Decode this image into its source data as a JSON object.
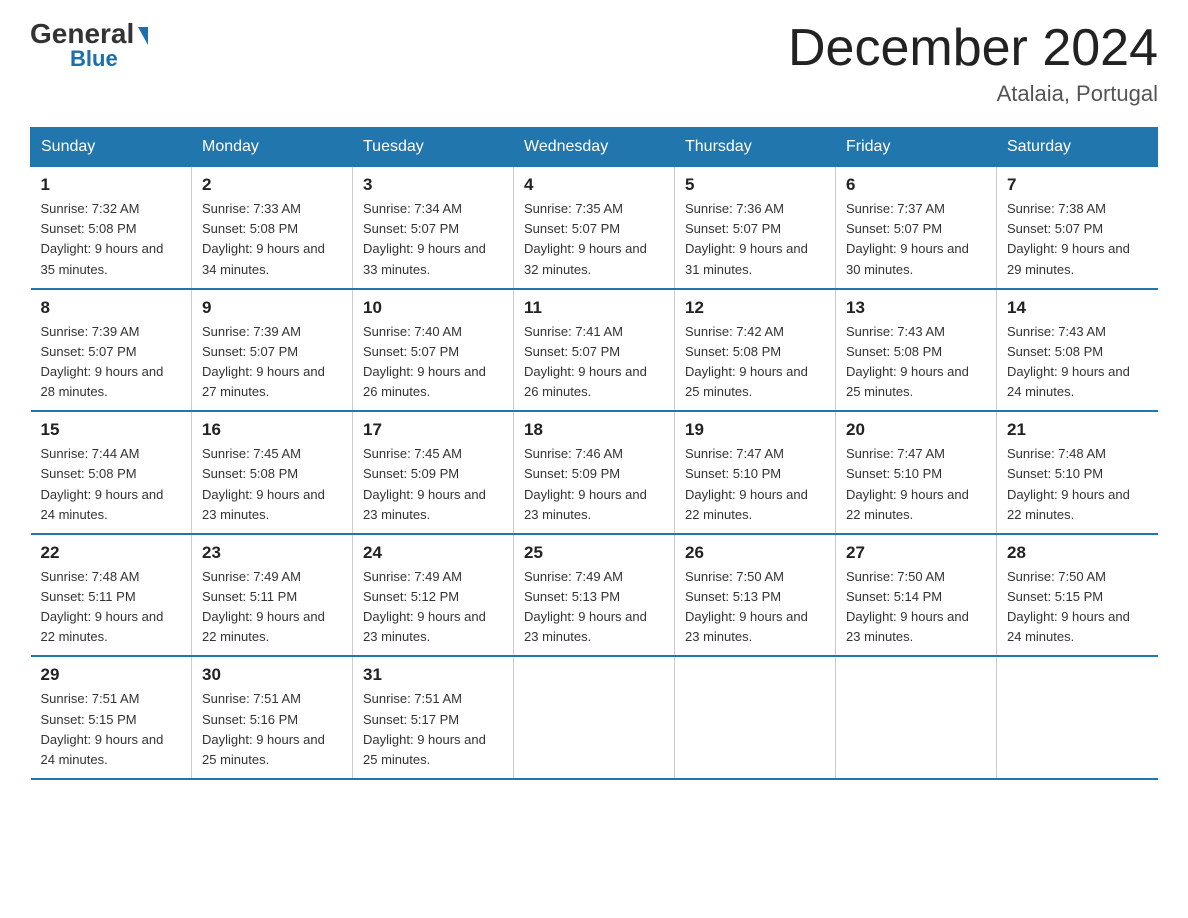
{
  "logo": {
    "text1": "General",
    "text2": "Blue"
  },
  "title": "December 2024",
  "location": "Atalaia, Portugal",
  "days_of_week": [
    "Sunday",
    "Monday",
    "Tuesday",
    "Wednesday",
    "Thursday",
    "Friday",
    "Saturday"
  ],
  "weeks": [
    [
      {
        "num": "1",
        "sunrise": "7:32 AM",
        "sunset": "5:08 PM",
        "daylight": "9 hours and 35 minutes."
      },
      {
        "num": "2",
        "sunrise": "7:33 AM",
        "sunset": "5:08 PM",
        "daylight": "9 hours and 34 minutes."
      },
      {
        "num": "3",
        "sunrise": "7:34 AM",
        "sunset": "5:07 PM",
        "daylight": "9 hours and 33 minutes."
      },
      {
        "num": "4",
        "sunrise": "7:35 AM",
        "sunset": "5:07 PM",
        "daylight": "9 hours and 32 minutes."
      },
      {
        "num": "5",
        "sunrise": "7:36 AM",
        "sunset": "5:07 PM",
        "daylight": "9 hours and 31 minutes."
      },
      {
        "num": "6",
        "sunrise": "7:37 AM",
        "sunset": "5:07 PM",
        "daylight": "9 hours and 30 minutes."
      },
      {
        "num": "7",
        "sunrise": "7:38 AM",
        "sunset": "5:07 PM",
        "daylight": "9 hours and 29 minutes."
      }
    ],
    [
      {
        "num": "8",
        "sunrise": "7:39 AM",
        "sunset": "5:07 PM",
        "daylight": "9 hours and 28 minutes."
      },
      {
        "num": "9",
        "sunrise": "7:39 AM",
        "sunset": "5:07 PM",
        "daylight": "9 hours and 27 minutes."
      },
      {
        "num": "10",
        "sunrise": "7:40 AM",
        "sunset": "5:07 PM",
        "daylight": "9 hours and 26 minutes."
      },
      {
        "num": "11",
        "sunrise": "7:41 AM",
        "sunset": "5:07 PM",
        "daylight": "9 hours and 26 minutes."
      },
      {
        "num": "12",
        "sunrise": "7:42 AM",
        "sunset": "5:08 PM",
        "daylight": "9 hours and 25 minutes."
      },
      {
        "num": "13",
        "sunrise": "7:43 AM",
        "sunset": "5:08 PM",
        "daylight": "9 hours and 25 minutes."
      },
      {
        "num": "14",
        "sunrise": "7:43 AM",
        "sunset": "5:08 PM",
        "daylight": "9 hours and 24 minutes."
      }
    ],
    [
      {
        "num": "15",
        "sunrise": "7:44 AM",
        "sunset": "5:08 PM",
        "daylight": "9 hours and 24 minutes."
      },
      {
        "num": "16",
        "sunrise": "7:45 AM",
        "sunset": "5:08 PM",
        "daylight": "9 hours and 23 minutes."
      },
      {
        "num": "17",
        "sunrise": "7:45 AM",
        "sunset": "5:09 PM",
        "daylight": "9 hours and 23 minutes."
      },
      {
        "num": "18",
        "sunrise": "7:46 AM",
        "sunset": "5:09 PM",
        "daylight": "9 hours and 23 minutes."
      },
      {
        "num": "19",
        "sunrise": "7:47 AM",
        "sunset": "5:10 PM",
        "daylight": "9 hours and 22 minutes."
      },
      {
        "num": "20",
        "sunrise": "7:47 AM",
        "sunset": "5:10 PM",
        "daylight": "9 hours and 22 minutes."
      },
      {
        "num": "21",
        "sunrise": "7:48 AM",
        "sunset": "5:10 PM",
        "daylight": "9 hours and 22 minutes."
      }
    ],
    [
      {
        "num": "22",
        "sunrise": "7:48 AM",
        "sunset": "5:11 PM",
        "daylight": "9 hours and 22 minutes."
      },
      {
        "num": "23",
        "sunrise": "7:49 AM",
        "sunset": "5:11 PM",
        "daylight": "9 hours and 22 minutes."
      },
      {
        "num": "24",
        "sunrise": "7:49 AM",
        "sunset": "5:12 PM",
        "daylight": "9 hours and 23 minutes."
      },
      {
        "num": "25",
        "sunrise": "7:49 AM",
        "sunset": "5:13 PM",
        "daylight": "9 hours and 23 minutes."
      },
      {
        "num": "26",
        "sunrise": "7:50 AM",
        "sunset": "5:13 PM",
        "daylight": "9 hours and 23 minutes."
      },
      {
        "num": "27",
        "sunrise": "7:50 AM",
        "sunset": "5:14 PM",
        "daylight": "9 hours and 23 minutes."
      },
      {
        "num": "28",
        "sunrise": "7:50 AM",
        "sunset": "5:15 PM",
        "daylight": "9 hours and 24 minutes."
      }
    ],
    [
      {
        "num": "29",
        "sunrise": "7:51 AM",
        "sunset": "5:15 PM",
        "daylight": "9 hours and 24 minutes."
      },
      {
        "num": "30",
        "sunrise": "7:51 AM",
        "sunset": "5:16 PM",
        "daylight": "9 hours and 25 minutes."
      },
      {
        "num": "31",
        "sunrise": "7:51 AM",
        "sunset": "5:17 PM",
        "daylight": "9 hours and 25 minutes."
      },
      {
        "num": "",
        "sunrise": "",
        "sunset": "",
        "daylight": ""
      },
      {
        "num": "",
        "sunrise": "",
        "sunset": "",
        "daylight": ""
      },
      {
        "num": "",
        "sunrise": "",
        "sunset": "",
        "daylight": ""
      },
      {
        "num": "",
        "sunrise": "",
        "sunset": "",
        "daylight": ""
      }
    ]
  ],
  "labels": {
    "sunrise_prefix": "Sunrise: ",
    "sunset_prefix": "Sunset: ",
    "daylight_prefix": "Daylight: "
  }
}
